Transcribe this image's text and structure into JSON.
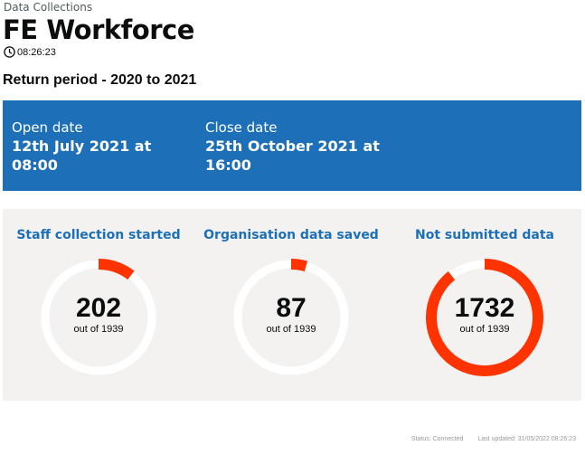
{
  "header": {
    "caption": "Data Collections",
    "title": "FE Workforce",
    "clock_time": "08:26:23",
    "clock_icon": "clock-icon"
  },
  "period": "Return period - 2020 to 2021",
  "banner": {
    "open_label": "Open date",
    "open_value": "12th July 2021 at 08:00",
    "close_label": "Close date",
    "close_value": "25th October 2021 at 16:00"
  },
  "stats": [
    {
      "heading": "Staff collection started",
      "value": "202",
      "count": 202,
      "out_of": "out of 1939",
      "total": 1939
    },
    {
      "heading": "Organisation data saved",
      "value": "87",
      "count": 87,
      "out_of": "out of 1939",
      "total": 1939
    },
    {
      "heading": "Not submitted data",
      "value": "1732",
      "count": 1732,
      "out_of": "out of 1939",
      "total": 1939
    }
  ],
  "footer": {
    "status": "Status: Connected",
    "last_updated": "Last updated: 31/05/2022 08:26:23"
  },
  "colors": {
    "banner_bg": "#1d70b8",
    "heading": "#1d70b8",
    "ring_progress": "#ff3300",
    "ring_track": "#ffffff",
    "panel_bg": "#f3f2f1"
  }
}
